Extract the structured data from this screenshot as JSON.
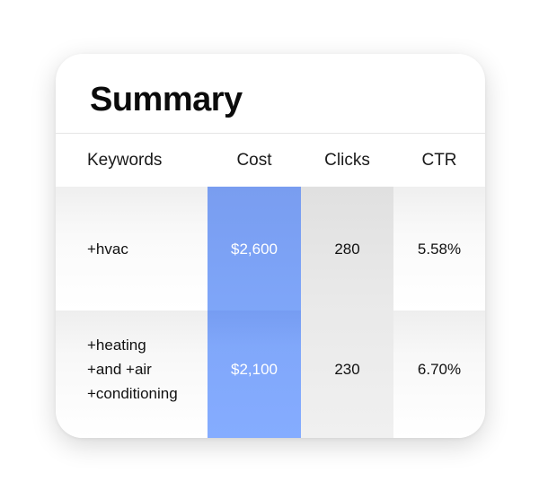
{
  "summary": {
    "title": "Summary",
    "columns": {
      "keywords": "Keywords",
      "cost": "Cost",
      "clicks": "Clicks",
      "ctr": "CTR"
    },
    "rows": [
      {
        "keyword_lines": [
          "+hvac"
        ],
        "cost": "$2,600",
        "clicks": "280",
        "ctr": "5.58%"
      },
      {
        "keyword_lines": [
          "+heating",
          "+and +air",
          "+conditioning"
        ],
        "cost": "$2,100",
        "clicks": "230",
        "ctr": "6.70%"
      }
    ]
  },
  "colors": {
    "cost_column": "#7ea5f8",
    "clicks_column": "#e9e9e9",
    "cost_text": "#ffffff"
  }
}
